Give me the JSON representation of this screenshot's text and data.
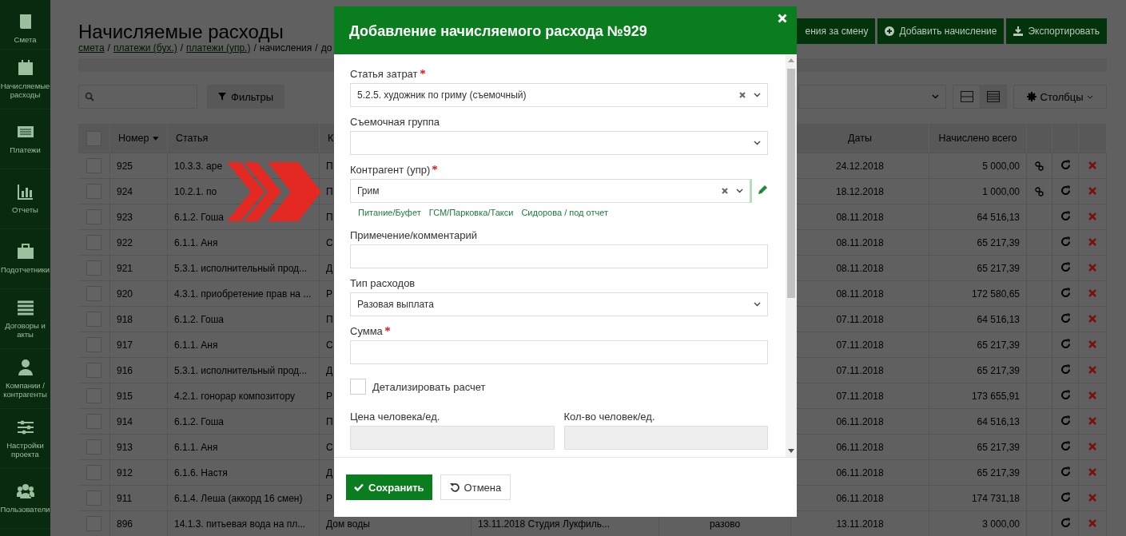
{
  "sidebar": {
    "items": [
      {
        "label": "Смета"
      },
      {
        "label": "Начисляемые расходы"
      },
      {
        "label": "Платежи"
      },
      {
        "label": "Отчеты"
      },
      {
        "label": "Подотчетники"
      },
      {
        "label": "Договоры и акты"
      },
      {
        "label": "Компании / контрагенты"
      },
      {
        "label": "Настройки проекта"
      },
      {
        "label": "Пользователи"
      }
    ]
  },
  "page": {
    "title": "Начисляемые расходы",
    "separator": "/",
    "breadcrumbs": [
      {
        "label": "смета",
        "link": true
      },
      {
        "label": "платежи (бух.)",
        "link": true
      },
      {
        "label": "платежи (упр.)",
        "link": true
      },
      {
        "label": "начисления",
        "link": false
      },
      {
        "label": "до",
        "link": false
      }
    ]
  },
  "actions": [
    {
      "label": "ения за смену"
    },
    {
      "label": "Добавить начисление"
    },
    {
      "label": "Экспортировать"
    }
  ],
  "toolbar": {
    "filters": "Фильтры",
    "columns": "Столбцы"
  },
  "table": {
    "all_checked": false,
    "columns": [
      {
        "label": "Номер",
        "sorted": true
      },
      {
        "label": "Статья",
        "sorted": false
      },
      {
        "label": "К"
      },
      {
        "label": "Даты",
        "sorted": false
      },
      {
        "label": "Начислено всего",
        "sorted": false
      }
    ],
    "rows": [
      {
        "checked": false,
        "number": "925",
        "article": "10.3.3. аре",
        "column_3": "П",
        "dates": "24.12.2018",
        "total": "5 000,00",
        "linked": true
      },
      {
        "checked": false,
        "number": "924",
        "article": "10.2.1. по",
        "column_3": "П",
        "dates": "18.12.2018",
        "total": "1 000,00",
        "linked": true
      },
      {
        "checked": false,
        "number": "923",
        "article": "6.1.2. Гоша",
        "column_3": "П",
        "dates": "08.11.2018",
        "total": "64 516,13",
        "linked": false
      },
      {
        "checked": false,
        "number": "922",
        "article": "6.1.1. Аня",
        "column_3": "С",
        "dates": "08.11.2018",
        "total": "65 217,39",
        "linked": false
      },
      {
        "checked": false,
        "number": "921",
        "article": "5.3.1. исполнительный прод...",
        "column_3": "Д",
        "dates": "08.11.2018",
        "total": "65 217,39",
        "linked": false
      },
      {
        "checked": false,
        "number": "920",
        "article": "4.3.1. приобретение прав на ...",
        "column_3": "Р",
        "dates": "08.11.2018",
        "total": "172 580,65",
        "linked": false
      },
      {
        "checked": false,
        "number": "918",
        "article": "6.1.2. Гоша",
        "column_3": "П",
        "dates": "07.11.2018",
        "total": "64 516,13",
        "linked": false
      },
      {
        "checked": false,
        "number": "917",
        "article": "6.1.1. Аня",
        "column_3": "С",
        "dates": "07.11.2018",
        "total": "65 217,39",
        "linked": false
      },
      {
        "checked": false,
        "number": "916",
        "article": "5.3.1. исполнительный прод...",
        "column_3": "Д",
        "dates": "07.11.2018",
        "total": "65 217,39",
        "linked": false
      },
      {
        "checked": false,
        "number": "915",
        "article": "4.2.1. гонорар композитору",
        "column_3": "Р",
        "dates": "07.11.2018",
        "total": "173 655,91",
        "linked": false
      },
      {
        "checked": false,
        "number": "914",
        "article": "6.1.2. Гоша",
        "column_3": "П",
        "dates": "06.11.2018",
        "total": "64 516,13",
        "linked": false
      },
      {
        "checked": false,
        "number": "913",
        "article": "6.1.1. Аня",
        "column_3": "С",
        "dates": "06.11.2018",
        "total": "65 217,39",
        "linked": false
      },
      {
        "checked": false,
        "number": "912",
        "article": "6.1.6. Настя",
        "column_3": "Д",
        "dates": "06.11.2018",
        "total": "65 217,39",
        "linked": false
      },
      {
        "checked": false,
        "number": "911",
        "article": "6.1.4. Леша (аккорд 16 смен)",
        "column_3": "Р",
        "dates": "06.11.2018",
        "total": "174 731,18",
        "linked": false
      },
      {
        "checked": false,
        "number": "896",
        "article": "14.1.3. питьевая вода на пл...",
        "column_3": "Дом воды",
        "column_4": "13.11.2018 Студия Лукфиль...",
        "column_5": "разово",
        "dates": "13.11.2018",
        "total": "3 000,00",
        "linked": false
      }
    ]
  },
  "modal": {
    "title": "Добавление начисляемого расхода №929",
    "fields": [
      {
        "kind": "select",
        "label": "Статья затрат",
        "required": true,
        "value": "5.2.5. художник по гриму (съемочный)",
        "clearable": true
      },
      {
        "kind": "select",
        "label": "Съемочная группа",
        "required": false,
        "clearable": false
      },
      {
        "kind": "select",
        "label": "Контрагент (упр)",
        "required": true,
        "value": "Грим",
        "clearable": true,
        "editable": true,
        "suggestions": [
          "Питание/Буфет",
          "ГСМ/Парковка/Такси",
          "Сидорова / под отчет"
        ]
      },
      {
        "kind": "input",
        "label": "Примечение/комментарий",
        "required": false
      },
      {
        "kind": "select",
        "label": "Тип расходов",
        "required": false,
        "value": "Разовая выплата",
        "clearable": false
      },
      {
        "kind": "input",
        "label": "Сумма",
        "required": true
      },
      {
        "kind": "checkbox",
        "label": "Детализировать расчет",
        "checked": false
      },
      {
        "kind": "pair",
        "fields": [
          {
            "label": "Цена человека/ед.",
            "disabled": true
          },
          {
            "label": "Кол-во человек/ед.",
            "disabled": true
          }
        ]
      }
    ],
    "save": "Сохранить",
    "cancel": "Отмена"
  }
}
